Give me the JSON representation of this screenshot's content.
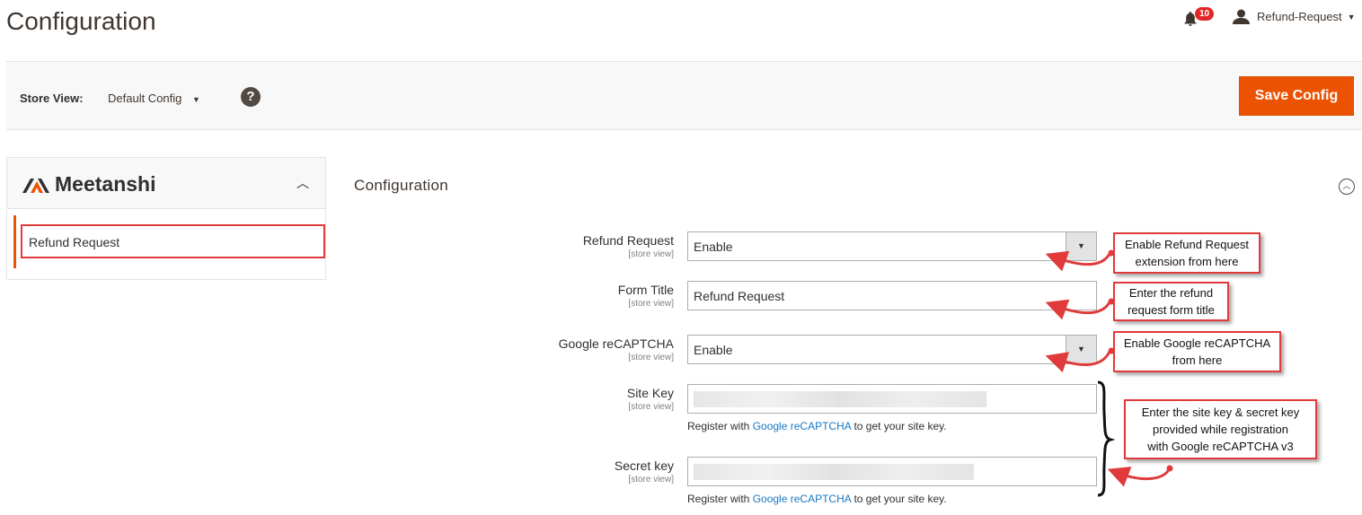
{
  "header": {
    "title": "Configuration",
    "notifications_count": "10",
    "user_name": "Refund-Request"
  },
  "toolbar": {
    "store_view_label": "Store View:",
    "store_view_value": "Default Config",
    "help_glyph": "?",
    "save_label": "Save Config"
  },
  "sidebar": {
    "brand": "Meetanshi",
    "items": [
      {
        "label": "Refund Request"
      }
    ]
  },
  "section": {
    "title": "Configuration"
  },
  "fields": [
    {
      "label": "Refund Request",
      "scope": "[store view]",
      "type": "select",
      "value": "Enable"
    },
    {
      "label": "Form Title",
      "scope": "[store view]",
      "type": "text",
      "value": "Refund Request"
    },
    {
      "label": "Google reCAPTCHA",
      "scope": "[store view]",
      "type": "select",
      "value": "Enable"
    },
    {
      "label": "Site Key",
      "scope": "[store view]",
      "type": "text",
      "value": "",
      "note_before": "Register with",
      "note_link": "Google reCAPTCHA",
      "note_after": "to get your site key."
    },
    {
      "label": "Secret key",
      "scope": "[store view]",
      "type": "text",
      "value": "",
      "note_before": "Register with",
      "note_link": "Google reCAPTCHA",
      "note_after": "to get your site key."
    }
  ],
  "callouts": [
    {
      "line1": "Enable Refund Request",
      "line2": "extension from here"
    },
    {
      "line1": "Enter the refund",
      "line2": "request form title"
    },
    {
      "line1": "Enable Google reCAPTCHA",
      "line2": "from here"
    },
    {
      "line1": "Enter the site key & secret key",
      "line2": "provided while registration",
      "line3": "with Google reCAPTCHA v3"
    }
  ],
  "colors": {
    "accent": "#eb5202",
    "annotation": "#e03a3a",
    "link": "#1979c3"
  }
}
